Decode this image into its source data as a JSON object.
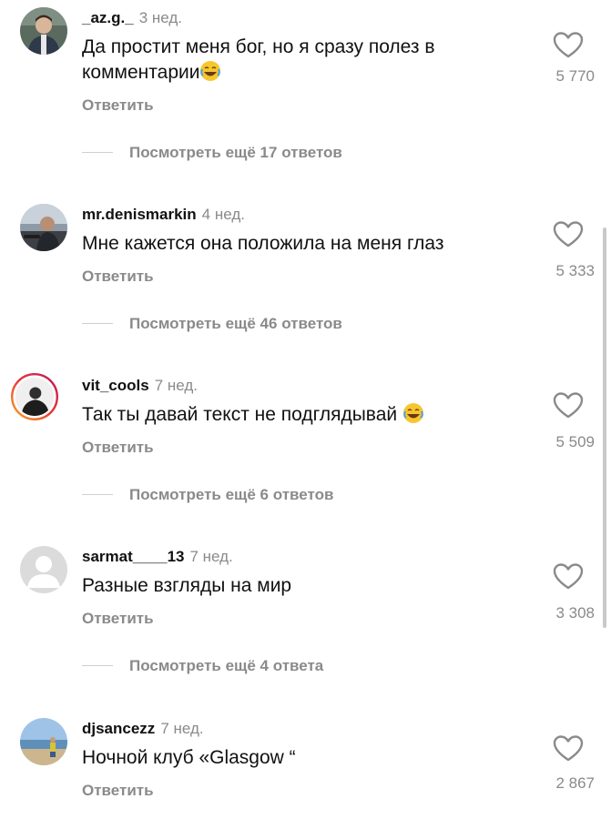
{
  "reply_label": "Ответить",
  "comments": [
    {
      "username": "_az.g._",
      "time": "3 нед.",
      "text": "Да простит меня бог, но я сразу полез в комментарии",
      "emoji": "😂",
      "likes": "5 770",
      "more": "Посмотреть ещё 17 ответов",
      "avatar": "man-portrait"
    },
    {
      "username": "mr.denismarkin",
      "time": "4 нед.",
      "text": "Мне кажется она положила на меня глаз",
      "emoji": "",
      "likes": "5 333",
      "more": "Посмотреть ещё 46 ответов",
      "avatar": "man-in-car"
    },
    {
      "username": "vit_cools",
      "time": "7 нед.",
      "text": "Так ты давай текст не подглядывай",
      "emoji": "😂",
      "likes": "5 509",
      "more": "Посмотреть ещё 6 ответов",
      "avatar": "man-story-ring"
    },
    {
      "username": "sarmat____13",
      "time": "7 нед.",
      "text": "Разные взгляды на мир",
      "emoji": "",
      "likes": "3 308",
      "more": "Посмотреть ещё 4 ответа",
      "avatar": "default-user"
    },
    {
      "username": "djsancezz",
      "time": "7 нед.",
      "text": "Ночной клуб «Glasgow “",
      "emoji": "",
      "likes": "2 867",
      "more": "",
      "avatar": "beach-photo"
    }
  ],
  "icons": {
    "like": "heart-outline-icon",
    "emoji": "laughing-emoji"
  },
  "colors": {
    "muted": "#8a8a8a",
    "story_ring_start": "#f9a825",
    "story_ring_end": "#c2185b"
  }
}
